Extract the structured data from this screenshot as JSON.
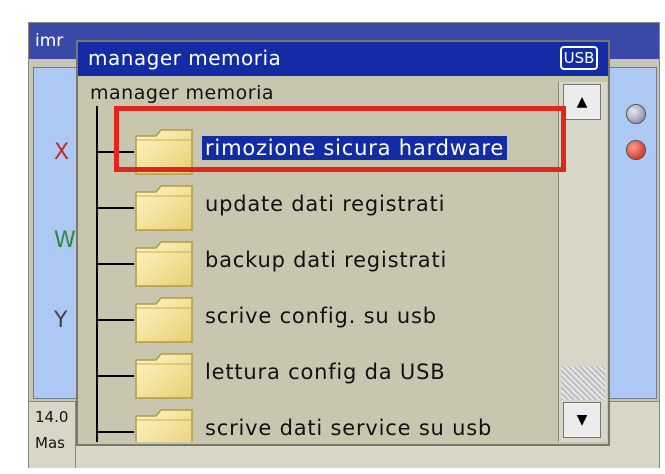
{
  "background_window": {
    "title": "imr",
    "axis_labels": [
      "X",
      "W",
      "Y"
    ],
    "status": {
      "value": "14.0",
      "mode": "Mas",
      "other": ""
    }
  },
  "dialog": {
    "title": "manager memoria",
    "badge": "USB",
    "tree_root": "manager memoria",
    "items": [
      {
        "label": "rimozione sicura hardware",
        "selected": true
      },
      {
        "label": "update dati registrati",
        "selected": false
      },
      {
        "label": "backup dati registrati",
        "selected": false
      },
      {
        "label": "scrive config. su usb",
        "selected": false
      },
      {
        "label": "lettura config da USB",
        "selected": false
      },
      {
        "label": "scrive dati service su usb",
        "selected": false
      }
    ],
    "scroll": {
      "up_icon": "triangle-up",
      "down_icon": "triangle-down"
    }
  },
  "colors": {
    "dialog_title_bg": "#132ca6",
    "selection_bg": "#132ca6",
    "annotation_red": "#e2251c",
    "content_blue": "#aec8f4"
  }
}
